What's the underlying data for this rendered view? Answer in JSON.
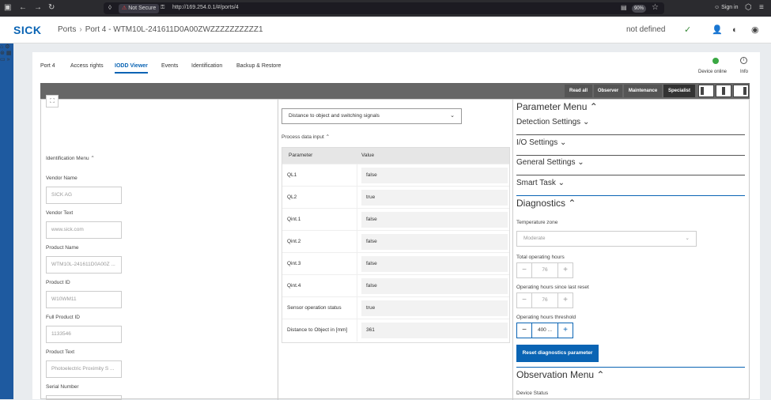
{
  "browser": {
    "not_secure": "Not Secure",
    "url": "http://169.254.0.1/#/ports/4",
    "zoom": "90%",
    "sign_in": "Sign in"
  },
  "header": {
    "logo": "SICK",
    "breadcrumb_root": "Ports",
    "breadcrumb_sep": "›",
    "breadcrumb_current": "Port 4 - WTM10L-241611D0A00ZWZZZZZZZZZZ1",
    "status": "not defined"
  },
  "tabs": [
    "Port 4",
    "Access rights",
    "IODD Viewer",
    "Events",
    "Identification",
    "Backup & Restore"
  ],
  "device_status": {
    "label": "Device online",
    "info": "Info"
  },
  "toolbar": {
    "read_all": "Read all",
    "roles": [
      "Observer",
      "Maintenance",
      "Specialist"
    ]
  },
  "identification": {
    "title": "Identification Menu",
    "fields": [
      {
        "label": "Vendor Name",
        "value": "SICK AG"
      },
      {
        "label": "Vendor Text",
        "value": "www.sick.com"
      },
      {
        "label": "Product Name",
        "value": "WTM10L-241611D0A00Z ..."
      },
      {
        "label": "Product ID",
        "value": "W10WM11"
      },
      {
        "label": "Full Product ID",
        "value": "1133546"
      },
      {
        "label": "Product Text",
        "value": "Photoelectric Proximity S ..."
      },
      {
        "label": "Serial Number",
        "value": ""
      }
    ]
  },
  "process": {
    "dropdown": "Distance to object and switching signals",
    "section_title": "Process data input",
    "columns": [
      "Parameter",
      "Value"
    ],
    "rows": [
      {
        "param": "QL1",
        "value": "false"
      },
      {
        "param": "QL2",
        "value": "true"
      },
      {
        "param": "Qint.1",
        "value": "false"
      },
      {
        "param": "Qint.2",
        "value": "false"
      },
      {
        "param": "Qint.3",
        "value": "false"
      },
      {
        "param": "Qint.4",
        "value": "false"
      },
      {
        "param": "Sensor operation status",
        "value": "true"
      },
      {
        "param": "Distance to Object in [mm]",
        "value": "361"
      }
    ]
  },
  "params": {
    "title": "Parameter Menu",
    "sections": [
      "Detection Settings",
      "I/O Settings",
      "General Settings",
      "Smart Task"
    ],
    "diagnostics": {
      "title": "Diagnostics",
      "temp_label": "Temperature zone",
      "temp_value": "Moderate",
      "total_label": "Total operating hours",
      "total_value": "76",
      "since_label": "Operating hours since last reset",
      "since_value": "76",
      "threshold_label": "Operating hours threshold",
      "threshold_value": "400 ...",
      "reset_button": "Reset diagnostics parameter"
    },
    "observation_title": "Observation Menu",
    "device_status_label": "Device Status"
  },
  "colors": {
    "brand": "#0a64b4",
    "sidebar": "#1e5aa0",
    "online": "#3aa843",
    "toolbar": "#666666"
  }
}
